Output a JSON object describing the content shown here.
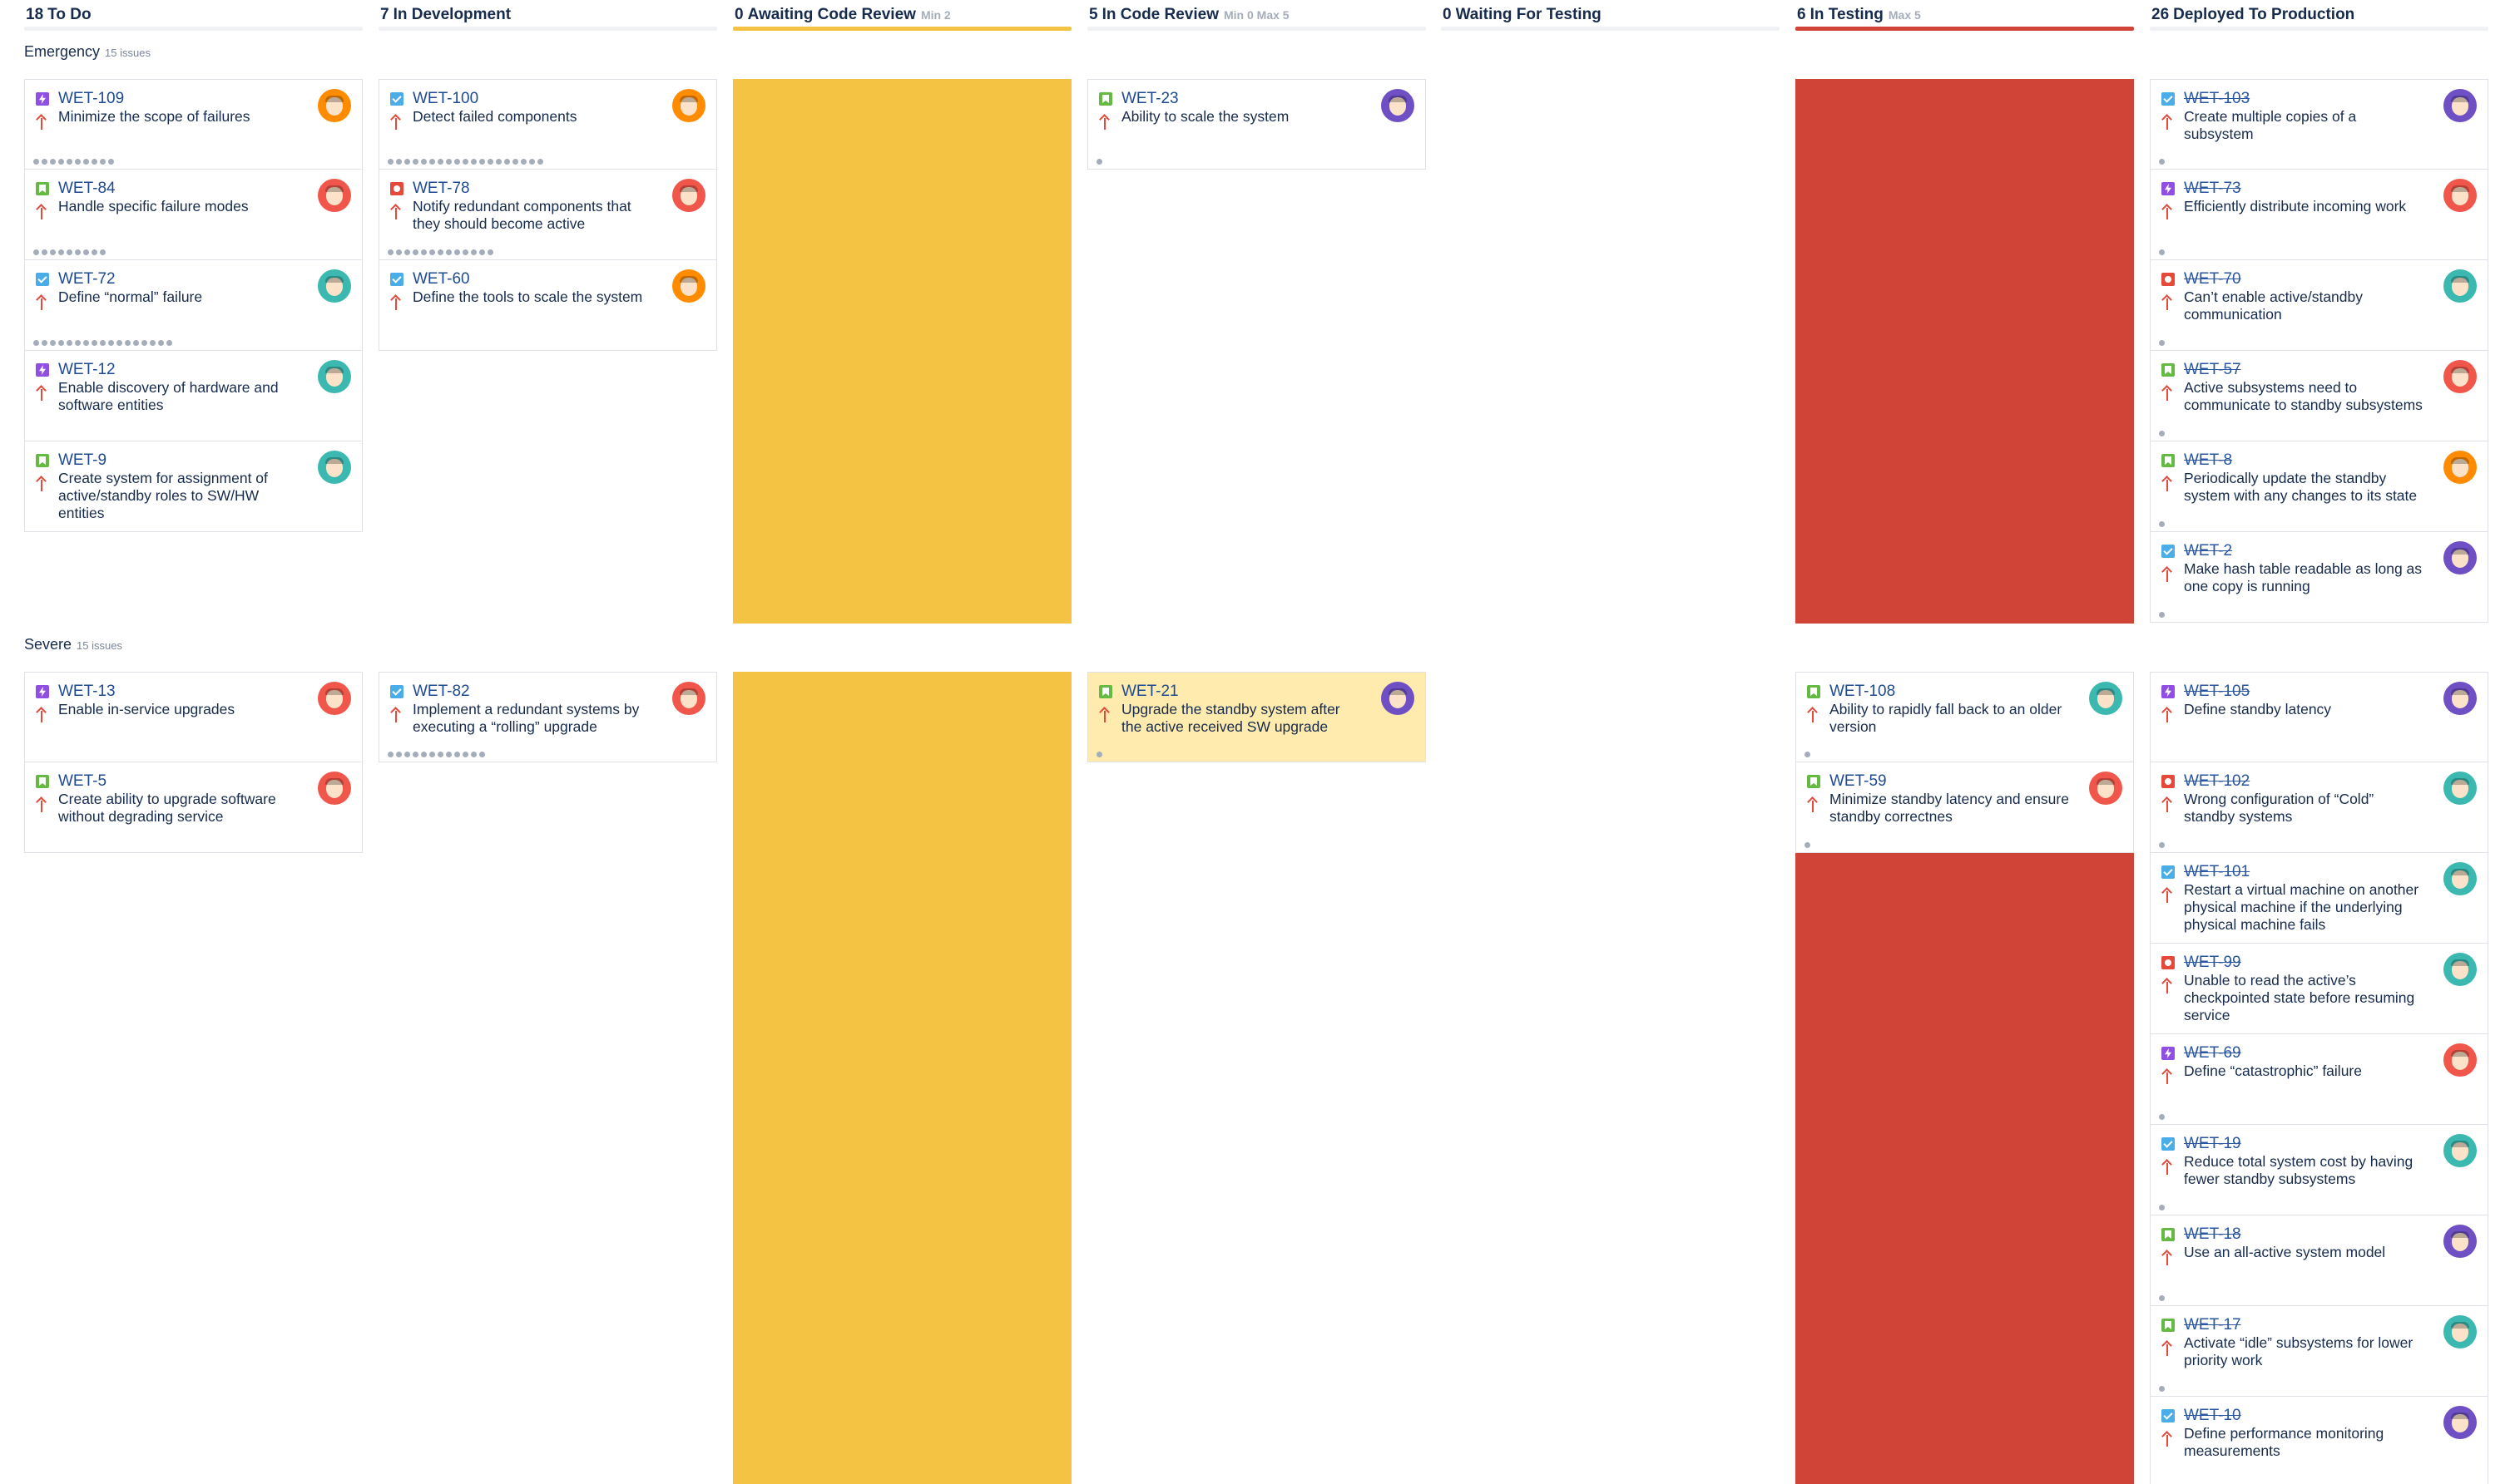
{
  "columns": [
    {
      "count": "18",
      "name": "To Do",
      "limits": "",
      "bar": "plain"
    },
    {
      "count": "7",
      "name": "In Development",
      "limits": "",
      "bar": "plain"
    },
    {
      "count": "0",
      "name": "Awaiting Code Review",
      "limits": "Min 2",
      "bar": "yellow"
    },
    {
      "count": "5",
      "name": "In Code Review",
      "limits": "Min 0  Max 5",
      "bar": "plain"
    },
    {
      "count": "0",
      "name": "Waiting For Testing",
      "limits": "",
      "bar": "plain"
    },
    {
      "count": "6",
      "name": "In Testing",
      "limits": "Max 5",
      "bar": "red"
    },
    {
      "count": "26",
      "name": "Deployed To Production",
      "limits": "",
      "bar": "plain"
    }
  ],
  "colors": {
    "min_violation": "#f5c343",
    "max_violation": "#d04437",
    "highlight_card": "#ffebad",
    "link": "#1e4a91"
  },
  "swimlanes": [
    {
      "name": "Emergency",
      "count_label": "15 issues",
      "cells": [
        {
          "fill": "",
          "cards": [
            {
              "key": "WET-109",
              "summary": "Minimize the scope of failures",
              "type": "epic-icon",
              "avatar": "orange",
              "dots": 10,
              "done": false
            },
            {
              "key": "WET-84",
              "summary": "Handle specific failure modes",
              "type": "story-icon",
              "avatar": "coral",
              "dots": 9,
              "done": false
            },
            {
              "key": "WET-72",
              "summary": "Define “normal” failure",
              "type": "task-icon",
              "avatar": "teal",
              "dots": 17,
              "done": false
            },
            {
              "key": "WET-12",
              "summary": "Enable discovery of hardware and software entities",
              "type": "epic-icon",
              "avatar": "teal",
              "dots": 0,
              "done": false
            },
            {
              "key": "WET-9",
              "summary": "Create system for assignment of active/standby roles to SW/HW entities",
              "type": "story-icon",
              "avatar": "teal",
              "dots": 0,
              "done": false
            }
          ]
        },
        {
          "fill": "",
          "cards": [
            {
              "key": "WET-100",
              "summary": "Detect failed components",
              "type": "task-icon",
              "avatar": "orange",
              "dots": 19,
              "done": false
            },
            {
              "key": "WET-78",
              "summary": "Notify redundant components that they should become active",
              "type": "bug-icon",
              "avatar": "coral",
              "dots": 13,
              "done": false
            },
            {
              "key": "WET-60",
              "summary": "Define the tools to scale the system",
              "type": "task-icon",
              "avatar": "orange",
              "dots": 0,
              "done": false
            }
          ]
        },
        {
          "fill": "yellow",
          "cards": []
        },
        {
          "fill": "",
          "cards": [
            {
              "key": "WET-23",
              "summary": "Ability to scale the system",
              "type": "story-icon",
              "avatar": "purple",
              "dots": 1,
              "done": false
            }
          ]
        },
        {
          "fill": "",
          "cards": []
        },
        {
          "fill": "red",
          "cards": []
        },
        {
          "fill": "",
          "cards": [
            {
              "key": "WET-103",
              "summary": "Create multiple copies of a subsystem",
              "type": "task-icon",
              "avatar": "purple",
              "dots": 1,
              "done": true
            },
            {
              "key": "WET-73",
              "summary": "Efficiently distribute incoming work",
              "type": "epic-icon",
              "avatar": "coral",
              "dots": 1,
              "done": true
            },
            {
              "key": "WET-70",
              "summary": "Can’t enable active/standby communication",
              "type": "bug-icon",
              "avatar": "teal",
              "dots": 1,
              "done": true
            },
            {
              "key": "WET-57",
              "summary": "Active subsystems need to communicate to standby subsystems",
              "type": "story-icon",
              "avatar": "coral",
              "dots": 1,
              "done": true
            },
            {
              "key": "WET-8",
              "summary": "Periodically update the standby system with any changes to its state",
              "type": "story-icon",
              "avatar": "orange",
              "dots": 1,
              "done": true
            },
            {
              "key": "WET-2",
              "summary": "Make hash table readable as long as one copy is running",
              "type": "task-icon",
              "avatar": "purple",
              "dots": 1,
              "done": true
            }
          ]
        }
      ]
    },
    {
      "name": "Severe",
      "count_label": "15 issues",
      "cells": [
        {
          "fill": "",
          "cards": [
            {
              "key": "WET-13",
              "summary": "Enable in-service upgrades",
              "type": "epic-icon",
              "avatar": "coral",
              "dots": 0,
              "done": false
            },
            {
              "key": "WET-5",
              "summary": "Create ability to upgrade software without degrading service",
              "type": "story-icon",
              "avatar": "coral",
              "dots": 0,
              "done": false
            }
          ]
        },
        {
          "fill": "",
          "cards": [
            {
              "key": "WET-82",
              "summary": "Implement a redundant systems by executing a “rolling” upgrade",
              "type": "task-icon",
              "avatar": "coral",
              "dots": 12,
              "done": false
            }
          ]
        },
        {
          "fill": "yellow",
          "cards": []
        },
        {
          "fill": "",
          "cards": [
            {
              "key": "WET-21",
              "summary": "Upgrade the standby system after the active received SW upgrade",
              "type": "story-icon",
              "avatar": "purple",
              "dots": 1,
              "done": false,
              "highlight": true
            }
          ]
        },
        {
          "fill": "",
          "cards": []
        },
        {
          "fill": "red",
          "cards": [
            {
              "key": "WET-108",
              "summary": "Ability to rapidly fall back to an older version",
              "type": "story-icon",
              "avatar": "teal",
              "dots": 1,
              "done": false
            },
            {
              "key": "WET-59",
              "summary": "Minimize standby latency and ensure standby correctnes",
              "type": "story-icon",
              "avatar": "coral",
              "dots": 1,
              "done": false
            }
          ]
        },
        {
          "fill": "",
          "cards": [
            {
              "key": "WET-105",
              "summary": "Define standby latency",
              "type": "epic-icon",
              "avatar": "purple",
              "dots": 0,
              "done": true
            },
            {
              "key": "WET-102",
              "summary": "Wrong configuration of “Cold” standby systems",
              "type": "bug-icon",
              "avatar": "teal",
              "dots": 1,
              "done": true
            },
            {
              "key": "WET-101",
              "summary": "Restart a virtual machine on another physical machine if the underlying physical machine fails",
              "type": "task-icon",
              "avatar": "teal",
              "dots": 0,
              "done": true
            },
            {
              "key": "WET-99",
              "summary": "Unable to read the active’s checkpointed state before resuming service",
              "type": "bug-icon",
              "avatar": "teal",
              "dots": 0,
              "done": true
            },
            {
              "key": "WET-69",
              "summary": "Define “catastrophic” failure",
              "type": "epic-icon",
              "avatar": "coral",
              "dots": 1,
              "done": true
            },
            {
              "key": "WET-19",
              "summary": "Reduce total system cost by having fewer standby subsystems",
              "type": "task-icon",
              "avatar": "teal",
              "dots": 1,
              "done": true
            },
            {
              "key": "WET-18",
              "summary": "Use an all-active system model",
              "type": "story-icon",
              "avatar": "purple",
              "dots": 1,
              "done": true
            },
            {
              "key": "WET-17",
              "summary": "Activate “idle” subsystems for lower priority work",
              "type": "story-icon",
              "avatar": "teal",
              "dots": 1,
              "done": true
            },
            {
              "key": "WET-10",
              "summary": "Define performance monitoring measurements",
              "type": "task-icon",
              "avatar": "purple",
              "dots": 0,
              "done": true
            }
          ]
        }
      ]
    }
  ]
}
